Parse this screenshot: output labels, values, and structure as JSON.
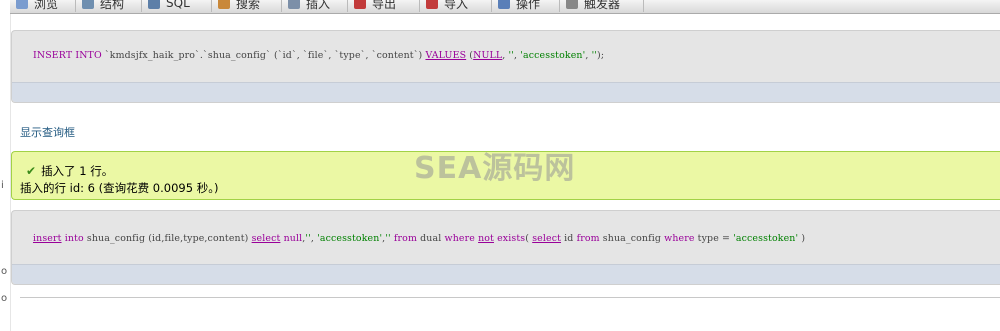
{
  "tabs": [
    {
      "label": "浏览",
      "icon": "browse-icon",
      "color": "#7a9ccf"
    },
    {
      "label": "结构",
      "icon": "structure-icon",
      "color": "#6f8fb0"
    },
    {
      "label": "SQL",
      "icon": "sql-icon",
      "color": "#5d7fa8"
    },
    {
      "label": "搜索",
      "icon": "search-icon",
      "color": "#c9883a"
    },
    {
      "label": "插入",
      "icon": "insert-icon",
      "color": "#7c8fa8"
    },
    {
      "label": "导出",
      "icon": "export-icon",
      "color": "#c23b3b"
    },
    {
      "label": "导入",
      "icon": "import-icon",
      "color": "#c23b3b"
    },
    {
      "label": "操作",
      "icon": "operations-icon",
      "color": "#5a7fb8"
    },
    {
      "label": "触发器",
      "icon": "triggers-icon",
      "color": "#888888"
    }
  ],
  "query1": {
    "p1": "INSERT INTO",
    "p2": " `kmdsjfx_haik_pro`.`shua_config` (`id`, `file`, `type`, `content`) ",
    "p3": "VALUES",
    "p4": " (",
    "p5": "NULL",
    "p6": ", ",
    "p7": "''",
    "p8": ", ",
    "p9": "'accesstoken'",
    "p10": ", ",
    "p11": "''",
    "p12": ");"
  },
  "show_query_link": "显示查询框",
  "success": {
    "line1": "插入了 1 行。",
    "line2": "插入的行 id: 6 (查询花费 0.0095 秒。)"
  },
  "query2": {
    "p1": "insert",
    "p2": " ",
    "p3": "into",
    "p4": " shua_config (id,file,type,content) ",
    "p5": "select",
    "p6": " ",
    "p7": "null",
    "p8": ",",
    "p9": "''",
    "p10": ", ",
    "p11": "'accesstoken'",
    "p12": ",",
    "p13": "''",
    "p14": " ",
    "p15": "from",
    "p16": " ",
    "p17": "dual",
    "p18": " ",
    "p19": "where",
    "p20": " ",
    "p21": "not",
    "p22": " ",
    "p23": "exists",
    "p24": "( ",
    "p25": "select",
    "p26": " id ",
    "p27": "from",
    "p28": " shua_config ",
    "p29": "where",
    "p30": " type = ",
    "p31": "'accesstoken'",
    "p32": " )"
  },
  "watermark": "SEA源码网",
  "left_strip": [
    "i",
    "o",
    "o"
  ]
}
